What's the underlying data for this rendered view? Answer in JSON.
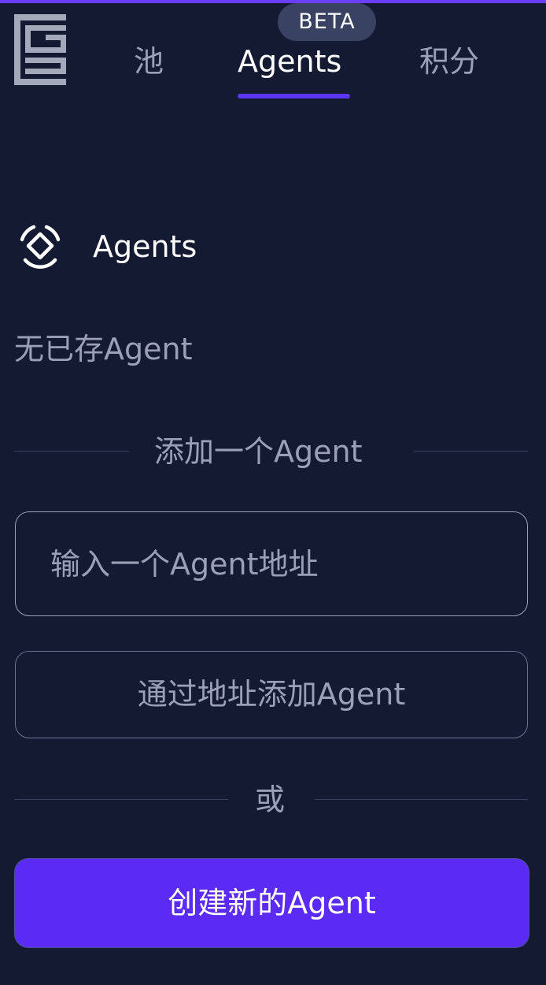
{
  "nav": {
    "tabs": [
      {
        "label": "池"
      },
      {
        "label": "Agents"
      },
      {
        "label": "积分"
      }
    ],
    "active_tab": "Agents",
    "badge": "BETA"
  },
  "section": {
    "title": "Agents",
    "icon": "agents-diamond-icon",
    "empty_text": "无已存Agent"
  },
  "add_form": {
    "divider_label": "添加一个Agent",
    "input_value": "",
    "input_placeholder": "输入一个Agent地址",
    "add_button_label": "通过地址添加Agent"
  },
  "or_label": "或",
  "create_button_label": "创建新的Agent",
  "colors": {
    "background": "#151a33",
    "accent": "#5b2bf3",
    "muted_text": "#9aa0b6",
    "badge_bg": "#3a4261"
  }
}
